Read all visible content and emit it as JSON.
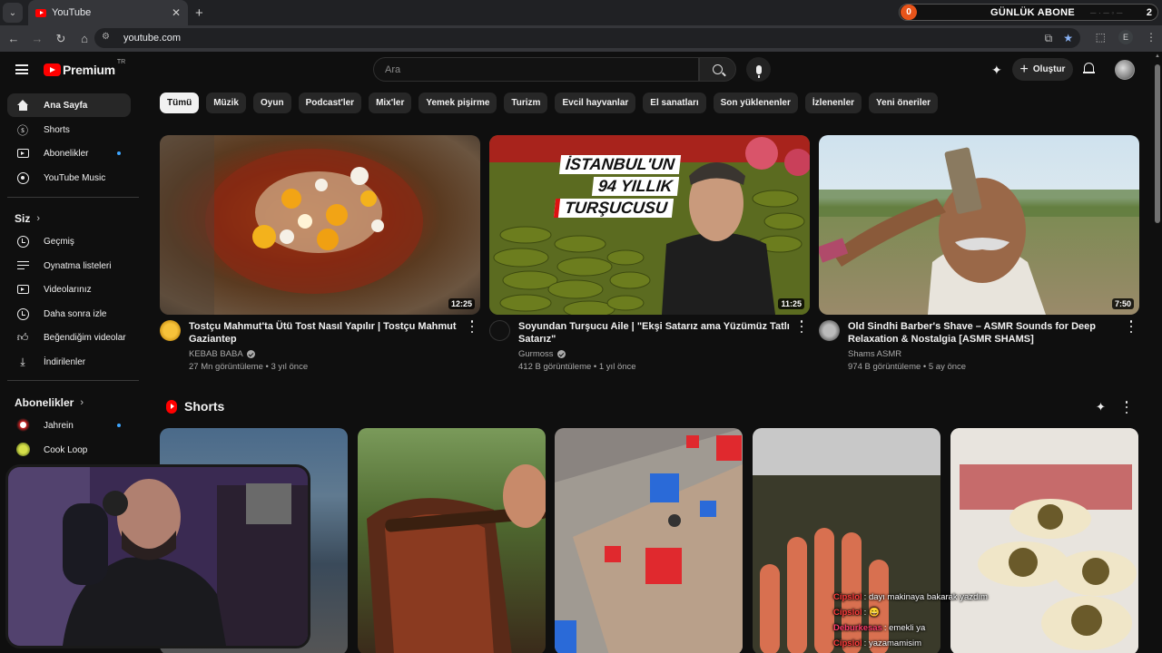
{
  "browser": {
    "tab_title": "YouTube",
    "tab_list_icon": "chevron-down-icon",
    "new_tab_symbol": "+",
    "close_symbol": "✕",
    "url": "youtube.com",
    "profile_letter": "E"
  },
  "overlay": {
    "left_count": "0",
    "label": "GÜNLÜK ABONE",
    "right_count": "2"
  },
  "header": {
    "logo_text": "Premium",
    "country_code": "TR",
    "search_placeholder": "Ara",
    "create_label": "Oluştur"
  },
  "sidebar": {
    "main": [
      {
        "label": "Ana Sayfa",
        "icon": "home-icon"
      },
      {
        "label": "Shorts",
        "icon": "shorts-icon"
      },
      {
        "label": "Abonelikler",
        "icon": "subscriptions-icon"
      },
      {
        "label": "YouTube Music",
        "icon": "youtube-music-icon"
      }
    ],
    "you_heading": "Siz",
    "you": [
      {
        "label": "Geçmiş",
        "icon": "history-icon"
      },
      {
        "label": "Oynatma listeleri",
        "icon": "playlists-icon"
      },
      {
        "label": "Videolarınız",
        "icon": "your-videos-icon"
      },
      {
        "label": "Daha sonra izle",
        "icon": "watch-later-icon"
      },
      {
        "label": "Beğendiğim videolar",
        "icon": "liked-videos-icon"
      },
      {
        "label": "İndirilenler",
        "icon": "downloads-icon"
      }
    ],
    "subs_heading": "Abonelikler",
    "subs": [
      {
        "label": "Jahrein"
      },
      {
        "label": "Cook Loop"
      }
    ]
  },
  "chips": [
    "Tümü",
    "Müzik",
    "Oyun",
    "Podcast'ler",
    "Mix'ler",
    "Yemek pişirme",
    "Turizm",
    "Evcil hayvanlar",
    "El sanatları",
    "Son yüklenenler",
    "İzlenenler",
    "Yeni öneriler"
  ],
  "videos": [
    {
      "title": "Tostçu Mahmut'ta Ütü Tost Nasıl Yapılır | Tostçu Mahmut Gaziantep",
      "channel": "KEBAB BABA",
      "stats": "27 Mn görüntüleme • 3 yıl önce",
      "duration": "12:25"
    },
    {
      "title": "Soyundan Turşucu Aile | \"Ekşi Satarız ama Yüzümüz Tatlı Satarız\"",
      "channel": "Gurmoss",
      "stats": "412 B görüntüleme • 1 yıl önce",
      "duration": "11:25",
      "overlay": [
        "İSTANBUL'UN",
        "94 YILLIK",
        "TURŞUCUSU"
      ]
    },
    {
      "title": "Old Sindhi Barber's Shave – ASMR Sounds for Deep Relaxation & Nostalgia [ASMR SHAMS]",
      "channel": "Shams ASMR",
      "stats": "974 B görüntüleme • 5 ay önce",
      "duration": "7:50"
    }
  ],
  "shorts": {
    "title": "Shorts"
  },
  "chat": [
    {
      "user": "Cipslol",
      "msg": ": dayı makinaya bakarak yazdım"
    },
    {
      "user": "Cipslol",
      "msg": ": 😄"
    },
    {
      "user": "Deburkesas",
      "msg": ": emekli ya"
    },
    {
      "user": "Cipslol",
      "msg": ": yazamamisim"
    }
  ],
  "colors": {
    "background": "#0f0f0f",
    "accent_red": "#ff0000",
    "chip_bg": "#272727",
    "link_blue": "#3ea6ff"
  }
}
